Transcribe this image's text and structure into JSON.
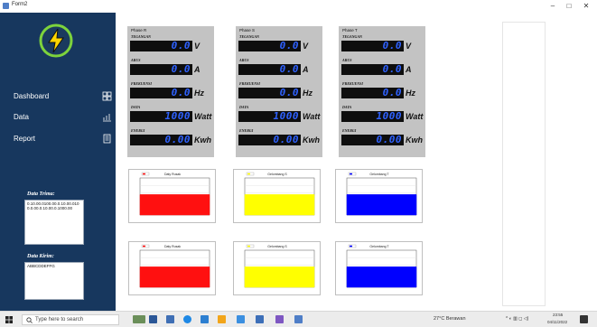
{
  "window": {
    "title": "Form2",
    "minimize": "–",
    "maximize": "□",
    "close": "✕"
  },
  "sidebar": {
    "logo_icon": "power-bolt-icon",
    "items": [
      {
        "label": "Dashboard",
        "icon": "dashboard-grid-icon"
      },
      {
        "label": "Data",
        "icon": "chart-icon"
      },
      {
        "label": "Report",
        "icon": "report-icon"
      }
    ],
    "data_terima": {
      "label": "Data Trima:",
      "value": "0.10.00.0100.00.0.10.00.0100.0.00.0.10.00.0.1000.00"
    },
    "data_kirim": {
      "label": "Data Kirim:",
      "value": "ABBCDDEFFG"
    }
  },
  "phases": [
    {
      "title": "Phase R",
      "readings": [
        {
          "label": "TEGANGAN",
          "value": "0.0",
          "unit": "V"
        },
        {
          "label": "ARUS",
          "value": "0.0",
          "unit": "A"
        },
        {
          "label": "FREKUENSI",
          "value": "0.0",
          "unit": "Hz"
        },
        {
          "label": "DAYA",
          "value": "1000",
          "unit": "Watt"
        },
        {
          "label": "ENERGI",
          "value": "0.00",
          "unit": "Kwh"
        }
      ]
    },
    {
      "title": "Phase S",
      "readings": [
        {
          "label": "TEGANGAN",
          "value": "0.0",
          "unit": "V"
        },
        {
          "label": "ARUS",
          "value": "0.0",
          "unit": "A"
        },
        {
          "label": "FREKUENSI",
          "value": "0.0",
          "unit": "Hz"
        },
        {
          "label": "DAYA",
          "value": "1000",
          "unit": "Watt"
        },
        {
          "label": "ENERGI",
          "value": "0.00",
          "unit": "Kwh"
        }
      ]
    },
    {
      "title": "Phase T",
      "readings": [
        {
          "label": "TEGANGAN",
          "value": "0.0",
          "unit": "V"
        },
        {
          "label": "ARUS",
          "value": "0.0",
          "unit": "A"
        },
        {
          "label": "FREKUENSI",
          "value": "0.0",
          "unit": "Hz"
        },
        {
          "label": "DAYA",
          "value": "1000",
          "unit": "Watt"
        },
        {
          "label": "ENERGI",
          "value": "0.00",
          "unit": "Kwh"
        }
      ]
    }
  ],
  "colors": {
    "sidebar": "#17375e",
    "lcd_bg": "#0e0e0e",
    "lcd_text": "#2f62ff",
    "phase_r": "#ff1010",
    "phase_s": "#ffff00",
    "phase_t": "#0000ff",
    "panel": "#c3c3c3"
  },
  "chart_data": [
    {
      "type": "area",
      "title": "Daty Rusak",
      "color": "#ff1010",
      "values": [
        0.55,
        0.55,
        0.55,
        0.55,
        0.55,
        0.55,
        0.55,
        0.55
      ],
      "ylim": [
        0,
        1
      ]
    },
    {
      "type": "area",
      "title": "Gelombang S",
      "color": "#ffff00",
      "values": [
        0.55,
        0.55,
        0.55,
        0.55,
        0.55,
        0.55,
        0.55,
        0.55
      ],
      "ylim": [
        0,
        1
      ]
    },
    {
      "type": "area",
      "title": "Gelombang T",
      "color": "#0000ff",
      "values": [
        0.55,
        0.55,
        0.55,
        0.55,
        0.55,
        0.55,
        0.55,
        0.55
      ],
      "ylim": [
        0,
        1
      ]
    },
    {
      "type": "area",
      "title": "Daty Rusak",
      "color": "#ff1010",
      "values": [
        0.55,
        0.55,
        0.55,
        0.55,
        0.55,
        0.55,
        0.55,
        0.55
      ],
      "ylim": [
        0,
        1
      ]
    },
    {
      "type": "area",
      "title": "Gelombang S",
      "color": "#ffff00",
      "values": [
        0.55,
        0.55,
        0.55,
        0.55,
        0.55,
        0.55,
        0.55,
        0.55
      ],
      "ylim": [
        0,
        1
      ]
    },
    {
      "type": "area",
      "title": "Gelombang T",
      "color": "#0000ff",
      "values": [
        0.55,
        0.55,
        0.55,
        0.55,
        0.55,
        0.55,
        0.55,
        0.55
      ],
      "ylim": [
        0,
        1
      ]
    }
  ],
  "taskbar": {
    "search_placeholder": "Type here to search",
    "weather": "27°C Berawan",
    "time": "23:55",
    "date": "04/11/2022"
  }
}
